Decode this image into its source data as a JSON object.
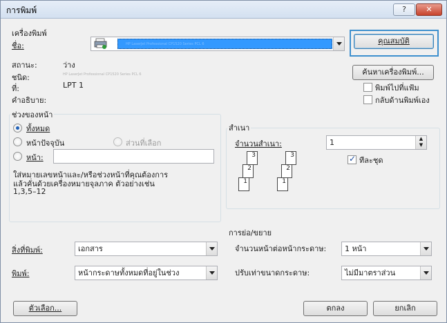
{
  "window": {
    "title": "การพิมพ์",
    "help": "?",
    "close": "✕"
  },
  "printer": {
    "group_label": "เครื่องพิมพ์",
    "name_label": "ชื่อ:",
    "name_label_underlined_char": "ชื่",
    "name_value": "HP LaserJet Professional CP1520 Series PCL 6",
    "properties_button": "คุณสมบัติ",
    "find_printer_button": "ค้นหาเครื่องพิมพ์...",
    "status_label": "สถานะ:",
    "status_value": "ว่าง",
    "type_label": "ชนิด:",
    "type_value": "HP LaserJet Professional CP1520 Series PCL 6",
    "where_label": "ที่:",
    "where_value": "LPT 1",
    "comment_label": "คำอธิบาย:",
    "print_to_file": "พิมพ์ไปที่แฟ้ม",
    "manual_duplex": "กลับด้านพิมพ์เอง",
    "print_to_file_checked": false,
    "manual_duplex_checked": false
  },
  "page_range": {
    "group_label": "ช่วงของหน้า",
    "all": "ทั้งหมด",
    "current": "หน้าปัจจุบัน",
    "selection": "ส่วนที่เลือก",
    "pages": "หน้า:",
    "pages_value": "",
    "help_text_1": "ใส่หมายเลขหน้าและ/หรือช่วงหน้าที่คุณต้องการ",
    "help_text_2": "แล้วคั่นด้วยเครื่องหมายจุลภาค ตัวอย่างเช่น",
    "help_text_3": "1,3,5–12",
    "selected": "all"
  },
  "copies": {
    "group_label": "สำเนา",
    "count_label": "จำนวนสำเนา:",
    "count_value": "1",
    "collate": "ทีละชุด",
    "collate_checked": true,
    "page_numbers": [
      "3",
      "2",
      "1",
      "3",
      "2",
      "1"
    ]
  },
  "print_what": {
    "label": "สิ่งที่พิมพ์:",
    "value": "เอกสาร"
  },
  "print": {
    "label": "พิมพ์:",
    "value": "หน้ากระดาษทั้งหมดที่อยู่ในช่วง"
  },
  "zoom": {
    "group_label": "การย่อ/ขยาย",
    "pages_per_sheet_label": "จำนวนหน้าต่อหน้ากระดาษ:",
    "pages_per_sheet_value": "1 หน้า",
    "scale_label": "ปรับเท่าขนาดกระดาษ:",
    "scale_value": "ไม่มีมาตราส่วน"
  },
  "footer": {
    "options_button": "ตัวเลือก...",
    "ok_button": "ตกลง",
    "cancel_button": "ยกเลิก"
  },
  "colors": {
    "accent": "#3399ff",
    "focus": "#3c8fce"
  }
}
